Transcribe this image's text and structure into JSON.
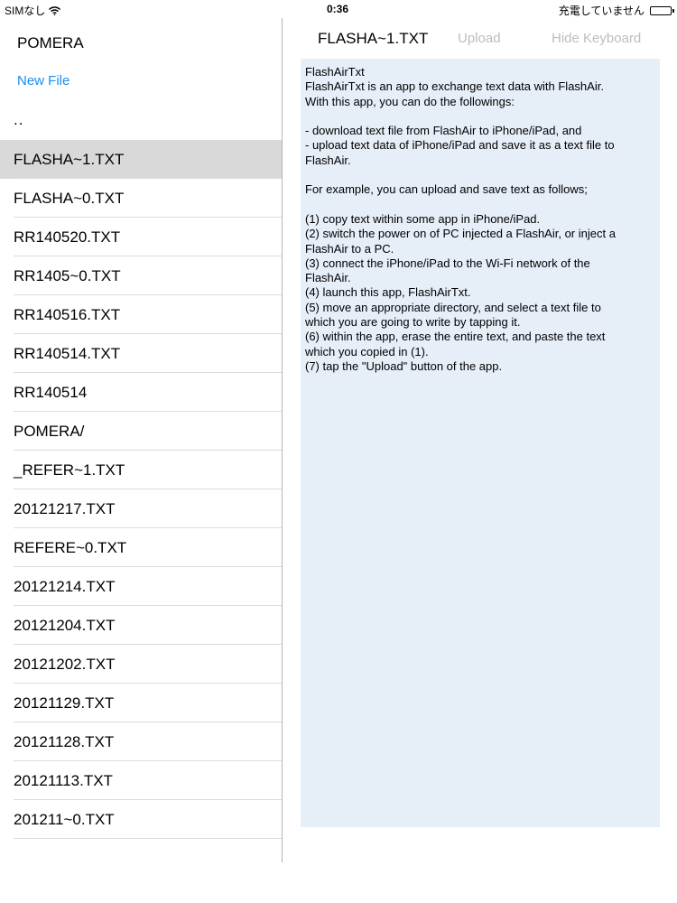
{
  "status_bar": {
    "carrier": "SIMなし",
    "time": "0:36",
    "charging": "充電していません"
  },
  "sidebar": {
    "title": "POMERA",
    "new_file": "New File",
    "parent_dir": "..",
    "files": [
      {
        "name": "FLASHA~1.TXT",
        "selected": true
      },
      {
        "name": "FLASHA~0.TXT"
      },
      {
        "name": "RR140520.TXT"
      },
      {
        "name": "RR1405~0.TXT"
      },
      {
        "name": "RR140516.TXT"
      },
      {
        "name": "RR140514.TXT"
      },
      {
        "name": "RR140514"
      },
      {
        "name": "POMERA/"
      },
      {
        "name": "_REFER~1.TXT"
      },
      {
        "name": "20121217.TXT"
      },
      {
        "name": "REFERE~0.TXT"
      },
      {
        "name": "20121214.TXT"
      },
      {
        "name": "20121204.TXT"
      },
      {
        "name": "20121202.TXT"
      },
      {
        "name": "20121129.TXT"
      },
      {
        "name": "20121128.TXT"
      },
      {
        "name": "20121113.TXT"
      },
      {
        "name": "201211~0.TXT"
      }
    ]
  },
  "editor": {
    "title": "FLASHA~1.TXT",
    "upload_label": "Upload",
    "hide_keyboard_label": "Hide Keyboard",
    "content": "FlashAirTxt\nFlashAirTxt is an app to exchange text data with FlashAir.\nWith this app, you can do the followings:\n\n- download text file from FlashAir to iPhone/iPad, and\n- upload text data of iPhone/iPad and save it as a text file to\nFlashAir.\n\nFor example, you can upload and save text as follows;\n\n(1) copy text within some app in iPhone/iPad.\n(2) switch the power on of PC injected a FlashAir, or inject a\nFlashAir to a PC.\n(3) connect the iPhone/iPad to the Wi-Fi network of the\nFlashAir.\n(4) launch this app, FlashAirTxt.\n(5) move an appropriate directory, and select a text file to\nwhich you are going to write by tapping it.\n(6) within the app, erase the entire text, and paste the text\nwhich you copied in (1).\n(7) tap the \"Upload\" button of the app."
  },
  "colors": {
    "accent": "#1a8ef0",
    "selected_row": "#d9d9d9",
    "editor_bg": "#e6eef7",
    "disabled_text": "#bdbdbd"
  },
  "icons": [
    "wifi-icon",
    "battery-icon"
  ]
}
